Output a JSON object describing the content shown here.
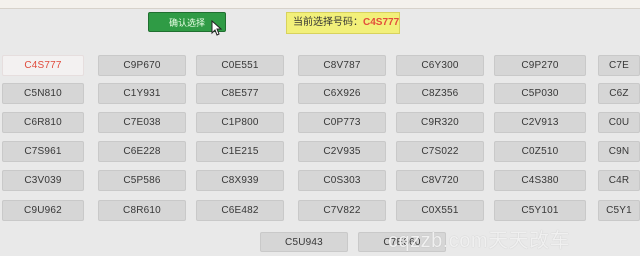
{
  "header": {
    "confirm_label": "确认选择",
    "current_label": "当前选择号码：",
    "current_code": "C4S777"
  },
  "codes": [
    [
      "C4S777",
      "C9P670",
      "C0E551",
      "C8V787",
      "C6Y300",
      "C9P270",
      "C7E"
    ],
    [
      "C5N810",
      "C1Y931",
      "C8E577",
      "C6X926",
      "C8Z356",
      "C5P030",
      "C6Z"
    ],
    [
      "C6R810",
      "C7E038",
      "C1P800",
      "C0P773",
      "C9R320",
      "C2V913",
      "C0U"
    ],
    [
      "C7S961",
      "C6E228",
      "C1E215",
      "C2V935",
      "C7S022",
      "C0Z510",
      "C9N"
    ],
    [
      "C3V039",
      "C5P586",
      "C8X939",
      "C0S303",
      "C8V720",
      "C4S380",
      "C4R"
    ],
    [
      "C9U962",
      "C8R610",
      "C6E482",
      "C7V822",
      "C0X551",
      "C5Y101",
      "C5Y1"
    ],
    [
      "",
      "",
      "",
      "C5U943",
      "C7E360",
      "",
      ""
    ]
  ],
  "watermark_text": "cqzzb.com天天改车",
  "colors": {
    "accent_red": "#e34d3b",
    "confirm_green": "#2f9b45",
    "highlight_yellow": "#f2f07a"
  }
}
